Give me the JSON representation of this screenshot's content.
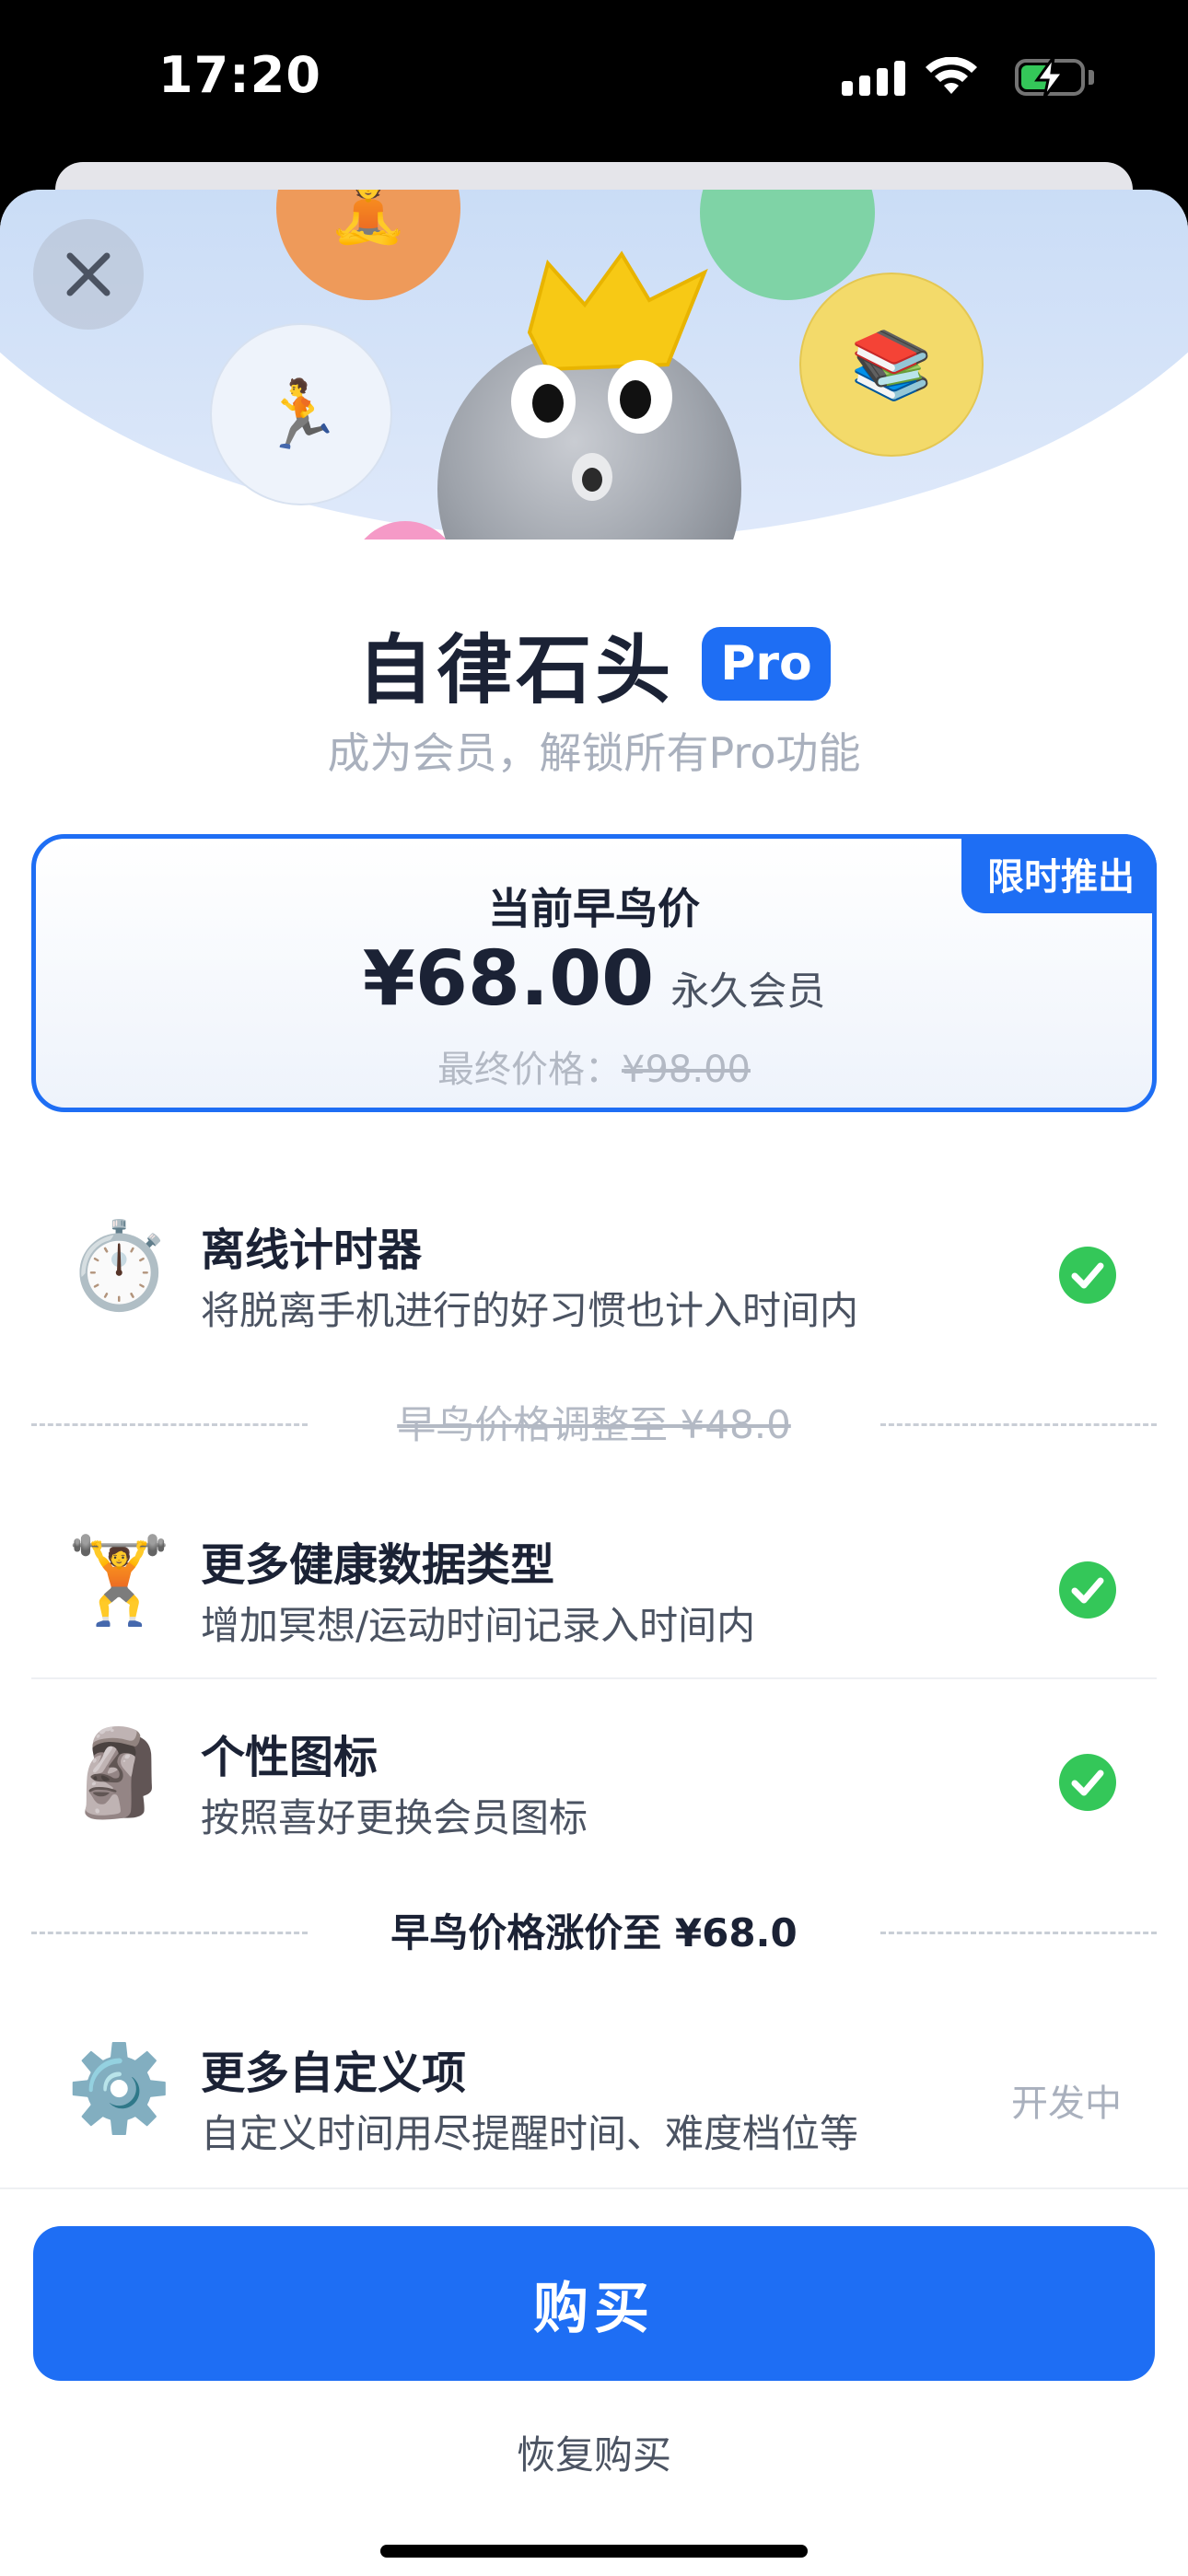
{
  "status_bar": {
    "time": "17:20",
    "battery_level": 0.5
  },
  "header": {
    "app_name": "自律石头",
    "pro_badge": "Pro",
    "subtitle": "成为会员，解锁所有Pro功能"
  },
  "hero_icons": [
    "person-in-lotus-icon",
    "runner-icon",
    "books-icon",
    "stone-mascot-with-crown"
  ],
  "price_card": {
    "tag": "限时推出",
    "label": "当前早鸟价",
    "price": "¥68.00",
    "unit": "永久会员",
    "final_label": "最终价格：",
    "final_price": "¥98.00"
  },
  "features": [
    {
      "icon": "stopwatch-icon",
      "title": "离线计时器",
      "desc": "将脱离手机进行的好习惯也计入时间内",
      "status": "included"
    },
    {
      "icon": "weightlifter-icon",
      "title": "更多健康数据类型",
      "desc": "增加冥想/运动时间记录入时间内",
      "status": "included"
    },
    {
      "icon": "moai-icon",
      "title": "个性图标",
      "desc": "按照喜好更换会员图标",
      "status": "included"
    },
    {
      "icon": "gear-icon",
      "title": "更多自定义项",
      "desc": "自定义时间用尽提醒时间、难度档位等",
      "status_text": "开发中"
    }
  ],
  "separators": {
    "first": "早鸟价格调整至 ¥48.0",
    "second": "早鸟价格涨价至 ¥68.0"
  },
  "actions": {
    "buy": "购买",
    "restore": "恢复购买"
  },
  "colors": {
    "accent": "#1e6ef4",
    "check": "#34c759",
    "title": "#1b2235"
  }
}
